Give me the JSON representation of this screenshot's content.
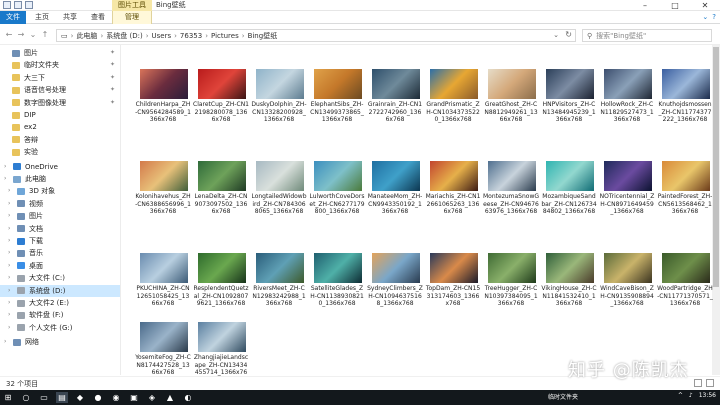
{
  "window": {
    "title": "Bing壁纸",
    "context_group": "图片工具",
    "tabs": [
      "文件",
      "主页",
      "共享",
      "查看",
      "管理"
    ]
  },
  "address": {
    "crumbs": [
      "此电脑",
      "系统盘 (D:)",
      "Users",
      "76353",
      "Pictures",
      "Bing壁纸"
    ],
    "search_placeholder": "搜索\"Bing壁纸\""
  },
  "nav": {
    "quick": [
      {
        "label": "图片",
        "color": "#6f8fb5"
      },
      {
        "label": "临时文件夹",
        "color": "#e8c35b"
      },
      {
        "label": "大三下",
        "color": "#e8c35b"
      },
      {
        "label": "语音信号处理",
        "color": "#e8c35b"
      },
      {
        "label": "数字图像处理",
        "color": "#e8c35b"
      }
    ],
    "folders": [
      {
        "label": "DIP",
        "color": "#e8c35b"
      },
      {
        "label": "ex2",
        "color": "#e8c35b"
      },
      {
        "label": "答辩",
        "color": "#e8c35b"
      },
      {
        "label": "实验",
        "color": "#e8c35b"
      }
    ],
    "onedrive": "OneDrive",
    "pc": "此电脑",
    "pc_items": [
      {
        "label": "3D 对象",
        "color": "#6fa6d8"
      },
      {
        "label": "视频",
        "color": "#6f8fb5"
      },
      {
        "label": "图片",
        "color": "#6f8fb5"
      },
      {
        "label": "文档",
        "color": "#6f8fb5"
      },
      {
        "label": "下载",
        "color": "#2d7dd2"
      },
      {
        "label": "音乐",
        "color": "#6f8fb5"
      },
      {
        "label": "桌面",
        "color": "#3a8ee6"
      },
      {
        "label": "大文件 (C:)",
        "color": "#9aa3ad"
      },
      {
        "label": "系统盘 (D:)",
        "color": "#9aa3ad"
      },
      {
        "label": "大文件2 (E:)",
        "color": "#9aa3ad"
      },
      {
        "label": "软件盘 (F:)",
        "color": "#9aa3ad"
      },
      {
        "label": "个人文件 (G:)",
        "color": "#9aa3ad"
      }
    ],
    "network": "网络"
  },
  "files": [
    {
      "name": "ChildrenHarpa_ZH-CN9564284589_1366x768",
      "c": [
        "#d9745a",
        "#6b2c3e",
        "#2a1d3a"
      ]
    },
    {
      "name": "ClaretCup_ZH-CN12198280078_1366x768",
      "c": [
        "#b91c1c",
        "#e0443a",
        "#3a1414"
      ]
    },
    {
      "name": "DuskyDolphin_ZH-CN13328200928_1366x768",
      "c": [
        "#8fb3c9",
        "#c4d6e0",
        "#5c7b8f"
      ]
    },
    {
      "name": "ElephantSibs_ZH-CN13499373865_1366x768",
      "c": [
        "#e0a24a",
        "#c4782a",
        "#6b4a22"
      ]
    },
    {
      "name": "Grainrain_ZH-CN12722742960_1366x768",
      "c": [
        "#2e4f6b",
        "#6f8a9a",
        "#1c2a36"
      ]
    },
    {
      "name": "GrandPrismatic_ZH-CN10343735220_1366x768",
      "c": [
        "#2c6fa8",
        "#e7a733",
        "#8a5a2a"
      ]
    },
    {
      "name": "GreatGhost_ZH-CN8812949261_1366x768",
      "c": [
        "#e6dcc8",
        "#d4a87a",
        "#8b6d4a"
      ]
    },
    {
      "name": "HNPVisitors_ZH-CN13484945239_1366x768",
      "c": [
        "#2b3f59",
        "#7c8ca3",
        "#1a2130"
      ]
    },
    {
      "name": "HollowRock_ZH-CN11829527473_1366x768",
      "c": [
        "#3c4e6e",
        "#8aa0b8",
        "#1e2633"
      ]
    },
    {
      "name": "Knuthojdsmossen_ZH-CN11774377222_1366x768",
      "c": [
        "#3a5ea0",
        "#9bb7d9",
        "#1b2b4b"
      ]
    },
    {
      "name": "Kolonihavehus_ZH-CN6388656996_1366x768",
      "c": [
        "#d37a4b",
        "#e8c17a",
        "#3f5f3a"
      ]
    },
    {
      "name": "LenaDelta_ZH-CN9073097502_1366x768",
      "c": [
        "#2f6b3a",
        "#6ea25a",
        "#1f3a24"
      ]
    },
    {
      "name": "LongtailedWidowbird_ZH-CN7843068065_1366x768",
      "c": [
        "#a7b9c2",
        "#d9e0dc",
        "#6f8a7a"
      ]
    },
    {
      "name": "LulworthCoveDorset_ZH-CN6277179800_1366x768",
      "c": [
        "#3c8fbf",
        "#7ec0c9",
        "#4a7a3a"
      ]
    },
    {
      "name": "ManateeMom_ZH-CN9943350192_1366x768",
      "c": [
        "#1f6fa1",
        "#3fa0c9",
        "#0c3650"
      ]
    },
    {
      "name": "Mariachis_ZH-CN12661065263_1366x768",
      "c": [
        "#c2452f",
        "#e6b04a",
        "#3c1a14"
      ]
    },
    {
      "name": "MontezumaSnowGeese_ZH-CN9467663976_1366x768",
      "c": [
        "#4f6f8f",
        "#c8d3dc",
        "#2a3b4d"
      ]
    },
    {
      "name": "MozambiqueSandbar_ZH-CN12673484802_1366x768",
      "c": [
        "#2fb4b1",
        "#92d8cf",
        "#0f6b74"
      ]
    },
    {
      "name": "NOTricentennial_ZH-CN8971649459_1366x768",
      "c": [
        "#1e2a5a",
        "#6b4ba0",
        "#0b1230"
      ]
    },
    {
      "name": "PaintedForest_ZH-CN5613568462_1366x768",
      "c": [
        "#d98a3a",
        "#e9c66a",
        "#6b3a1a"
      ]
    },
    {
      "name": "PKUCHINA_ZH-CN12651058425_1366x768",
      "c": [
        "#6a8caf",
        "#b8cfe0",
        "#3b5a76"
      ]
    },
    {
      "name": "ResplendentQuetzal_ZH-CN10928079621_1366x768",
      "c": [
        "#2e6b2c",
        "#6aa84f",
        "#17331a"
      ]
    },
    {
      "name": "RiversMeet_ZH-CN12983242988_1366x768",
      "c": [
        "#2a5d7a",
        "#5fa0b5",
        "#3d5a2a"
      ]
    },
    {
      "name": "SatelliteGlades_ZH-CN11389308210_1366x768",
      "c": [
        "#1f5f6f",
        "#4fb0a8",
        "#0d2b33"
      ]
    },
    {
      "name": "SydneyClimbers_ZH-CN10946375168_1366x768",
      "c": [
        "#e3a35a",
        "#7aa7c9",
        "#2a3b4f"
      ]
    },
    {
      "name": "TopDam_ZH-CN15313174603_1366x768",
      "c": [
        "#2a3a5a",
        "#d98a4a",
        "#1a1a2a"
      ]
    },
    {
      "name": "TreeHugger_ZH-CN10397384095_1366x768",
      "c": [
        "#3f6b34",
        "#8ab06a",
        "#1e3a1a"
      ]
    },
    {
      "name": "VikingHouse_ZH-CN11841532410_1366x768",
      "c": [
        "#2f5f3a",
        "#9ab77a",
        "#4a3a2a"
      ]
    },
    {
      "name": "WindCaveBison_ZH-CN9135908894_1366x768",
      "c": [
        "#5a6b3a",
        "#c9b36a",
        "#3a3320"
      ]
    },
    {
      "name": "WoodPartridge_ZH-CN11771370571_1366x768",
      "c": [
        "#3a5a2a",
        "#6e8f4a",
        "#2a2a1a"
      ]
    },
    {
      "name": "YosemiteFog_ZH-CN8174427528_1366x768",
      "c": [
        "#4a6a8a",
        "#9ab3c9",
        "#2a3a4a"
      ]
    },
    {
      "name": "ZhangjiajieLandscape_ZH-CN13434455714_1366x768",
      "c": [
        "#5a7fa0",
        "#c0d3df",
        "#2f4a5f"
      ]
    }
  ],
  "status": {
    "count": "32 个项目"
  },
  "watermark": "知乎 @陈凯杰",
  "taskbar": {
    "notif": "临时文件夹",
    "time": "13:56"
  }
}
